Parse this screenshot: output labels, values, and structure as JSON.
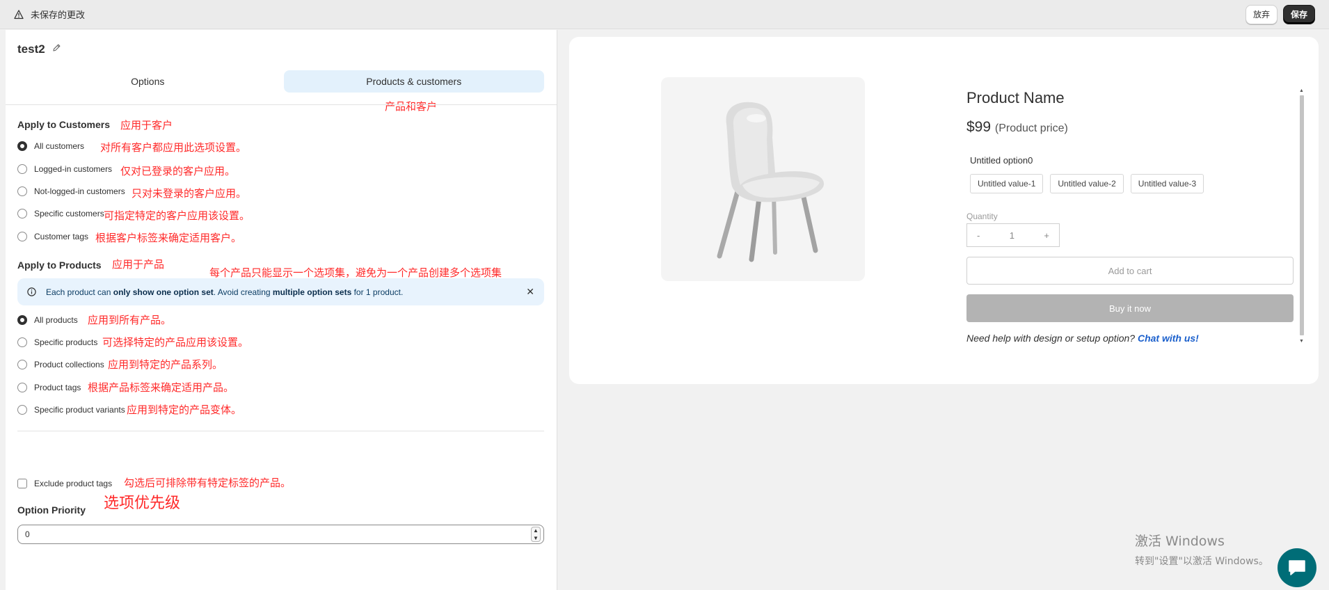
{
  "topbar": {
    "title": "未保存的更改",
    "discard": "放弃",
    "save": "保存"
  },
  "left": {
    "name": "test2",
    "tabs": [
      {
        "label": "Options"
      },
      {
        "label": "Products & customers"
      }
    ],
    "tab_note": "产品和客户",
    "customers": {
      "title": "Apply to Customers",
      "note": "应用于客户",
      "items": [
        {
          "label": "All customers",
          "note": "对所有客户都应用此选项设置。",
          "checked": true
        },
        {
          "label": "Logged-in customers",
          "note": "仅对已登录的客户应用。",
          "checked": false
        },
        {
          "label": "Not-logged-in customers",
          "note": "只对未登录的客户应用。",
          "checked": false
        },
        {
          "label": "Specific customers",
          "note": "可指定特定的客户应用该设置。",
          "checked": false
        },
        {
          "label": "Customer tags",
          "note": "根据客户标签来确定适用客户。",
          "checked": false
        }
      ]
    },
    "products": {
      "title": "Apply to Products",
      "note": "应用于产品",
      "banner_note": "每个产品只能显示一个选项集，避免为一个产品创建多个选项集",
      "banner": {
        "p1": "Each product can ",
        "b1": "only show one option set",
        "p2": ". Avoid creating ",
        "b2": "multiple option sets",
        "p3": " for 1 product."
      },
      "items": [
        {
          "label": "All products",
          "note": "应用到所有产品。",
          "checked": true
        },
        {
          "label": "Specific products",
          "note": "可选择特定的产品应用该设置。",
          "checked": false
        },
        {
          "label": "Product collections",
          "note": "应用到特定的产品系列。",
          "checked": false
        },
        {
          "label": "Product tags",
          "note": "根据产品标签来确定适用产品。",
          "checked": false
        },
        {
          "label": "Specific product variants",
          "note": "应用到特定的产品变体。",
          "checked": false
        }
      ]
    },
    "exclude": {
      "label": "Exclude product tags",
      "note": "勾选后可排除带有特定标签的产品。",
      "checked": false
    },
    "priority": {
      "title": "Option Priority",
      "note": "选项优先级",
      "value": "0"
    }
  },
  "preview": {
    "product_name": "Product Name",
    "price": "$99",
    "price_label": "(Product price)",
    "option_label": "Untitled option0",
    "option_values": [
      "Untitled value-1",
      "Untitled value-2",
      "Untitled value-3"
    ],
    "quantity_label": "Quantity",
    "qty_minus": "-",
    "qty_value": "1",
    "qty_plus": "+",
    "add_to_cart": "Add to cart",
    "buy_now": "Buy it now",
    "help_text": "Need help with design or setup option? ",
    "help_link": "Chat with us!"
  },
  "watermark": {
    "line1": "激活 Windows",
    "line2": "转到\"设置\"以激活 Windows。"
  },
  "colors": {
    "accent_tab": "#e3f1fc",
    "annotation": "#ff2a2a",
    "chat_fab": "#006d77",
    "link": "#1a5fcc"
  }
}
